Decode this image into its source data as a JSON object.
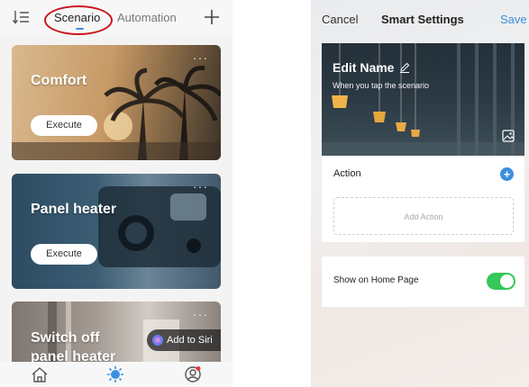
{
  "left": {
    "tabs": [
      {
        "label": "Scenario",
        "active": true
      },
      {
        "label": "Automation",
        "active": false
      }
    ],
    "icons": {
      "sort": "sort-icon",
      "add": "plus-icon"
    },
    "cards": [
      {
        "title": "Comfort",
        "action": "Execute",
        "more": "···"
      },
      {
        "title": "Panel heater",
        "action": "Execute",
        "more": "···"
      },
      {
        "title": "Switch off\npanel heater",
        "badge": "Add to Siri",
        "more": "···"
      }
    ],
    "bottom_nav": [
      "home-icon",
      "scene-icon",
      "profile-icon"
    ],
    "colors": {
      "accent": "#3a8fe0",
      "highlight_circle": "#c9171d"
    }
  },
  "right": {
    "nav": {
      "cancel": "Cancel",
      "title": "Smart Settings",
      "save": "Save"
    },
    "hero": {
      "name": "Edit Name",
      "subtitle": "When you tap the scenario"
    },
    "action": {
      "label": "Action",
      "add_placeholder": "Add Action"
    },
    "home_page": {
      "label": "Show on Home Page",
      "enabled": true
    },
    "colors": {
      "accent": "#3a8fe0",
      "toggle_on": "#34c759"
    }
  }
}
